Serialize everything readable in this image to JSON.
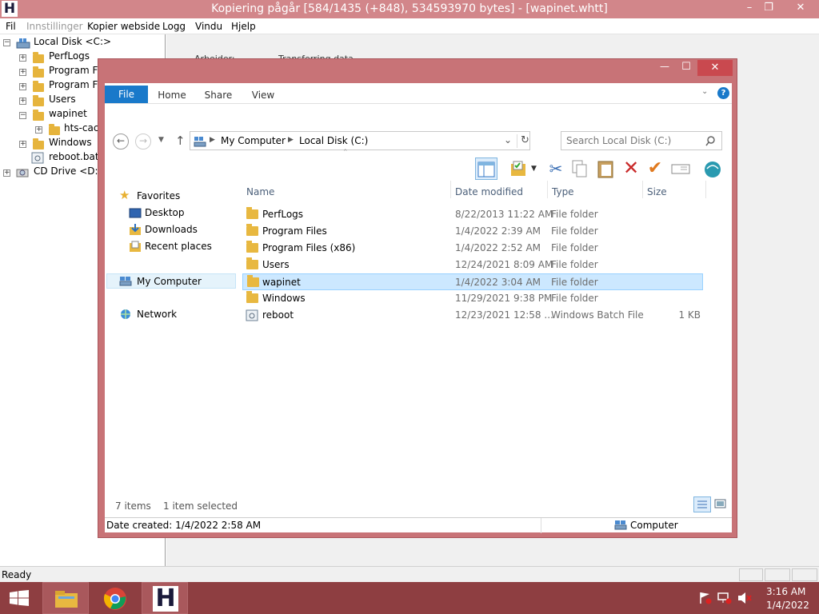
{
  "window": {
    "title": "Kopiering pågår [584/1435 (+848), 534593970 bytes] - [wapinet.whtt]",
    "logo": "H",
    "min": "–",
    "max": "❐",
    "close": "✕"
  },
  "menu": [
    "Fil",
    "Innstillinger",
    "Kopier webside",
    "Logg",
    "Vindu",
    "Hjelp"
  ],
  "tree": {
    "root": "Local Disk <C:>",
    "items": [
      "PerfLogs",
      "Program Fil",
      "Program Fil",
      "Users",
      "wapinet",
      "hts-cach",
      "Windows",
      "reboot.bat"
    ],
    "cd": "CD Drive <D:>"
  },
  "right_panel": {
    "label1": "Arbeider:",
    "label2": "Transferring data"
  },
  "status": "Ready",
  "explorer": {
    "ribbon_tabs": [
      "File",
      "Home",
      "Share",
      "View"
    ],
    "address": [
      "My Computer",
      "Local Disk (C:)"
    ],
    "search_placeholder": "Search Local Disk (C:)",
    "nav": {
      "favorites": "Favorites",
      "desktop": "Desktop",
      "downloads": "Downloads",
      "recent": "Recent places",
      "computer": "My Computer",
      "network": "Network"
    },
    "columns": [
      "Name",
      "Date modified",
      "Type",
      "Size"
    ],
    "rows": [
      {
        "name": "PerfLogs",
        "date": "8/22/2013 11:22 AM",
        "type": "File folder",
        "size": ""
      },
      {
        "name": "Program Files",
        "date": "1/4/2022 2:39 AM",
        "type": "File folder",
        "size": ""
      },
      {
        "name": "Program Files (x86)",
        "date": "1/4/2022 2:52 AM",
        "type": "File folder",
        "size": ""
      },
      {
        "name": "Users",
        "date": "12/24/2021 8:09 AM",
        "type": "File folder",
        "size": ""
      },
      {
        "name": "wapinet",
        "date": "1/4/2022 3:04 AM",
        "type": "File folder",
        "size": ""
      },
      {
        "name": "Windows",
        "date": "11/29/2021 9:38 PM",
        "type": "File folder",
        "size": ""
      },
      {
        "name": "reboot",
        "date": "12/23/2021 12:58 ...",
        "type": "Windows Batch File",
        "size": "1 KB"
      }
    ],
    "item_count": "7 items",
    "selection": "1 item selected",
    "date_created": "Date created: 1/4/2022 2:58 AM",
    "location": "Computer",
    "min": "—",
    "max": "☐",
    "close": "✕"
  },
  "taskbar": {
    "time": "3:16 AM",
    "date": "1/4/2022",
    "app_letter": "H"
  },
  "colors": {
    "accent": "#d2868a",
    "file_tab": "#1979ca",
    "selection": "#cce8ff"
  }
}
